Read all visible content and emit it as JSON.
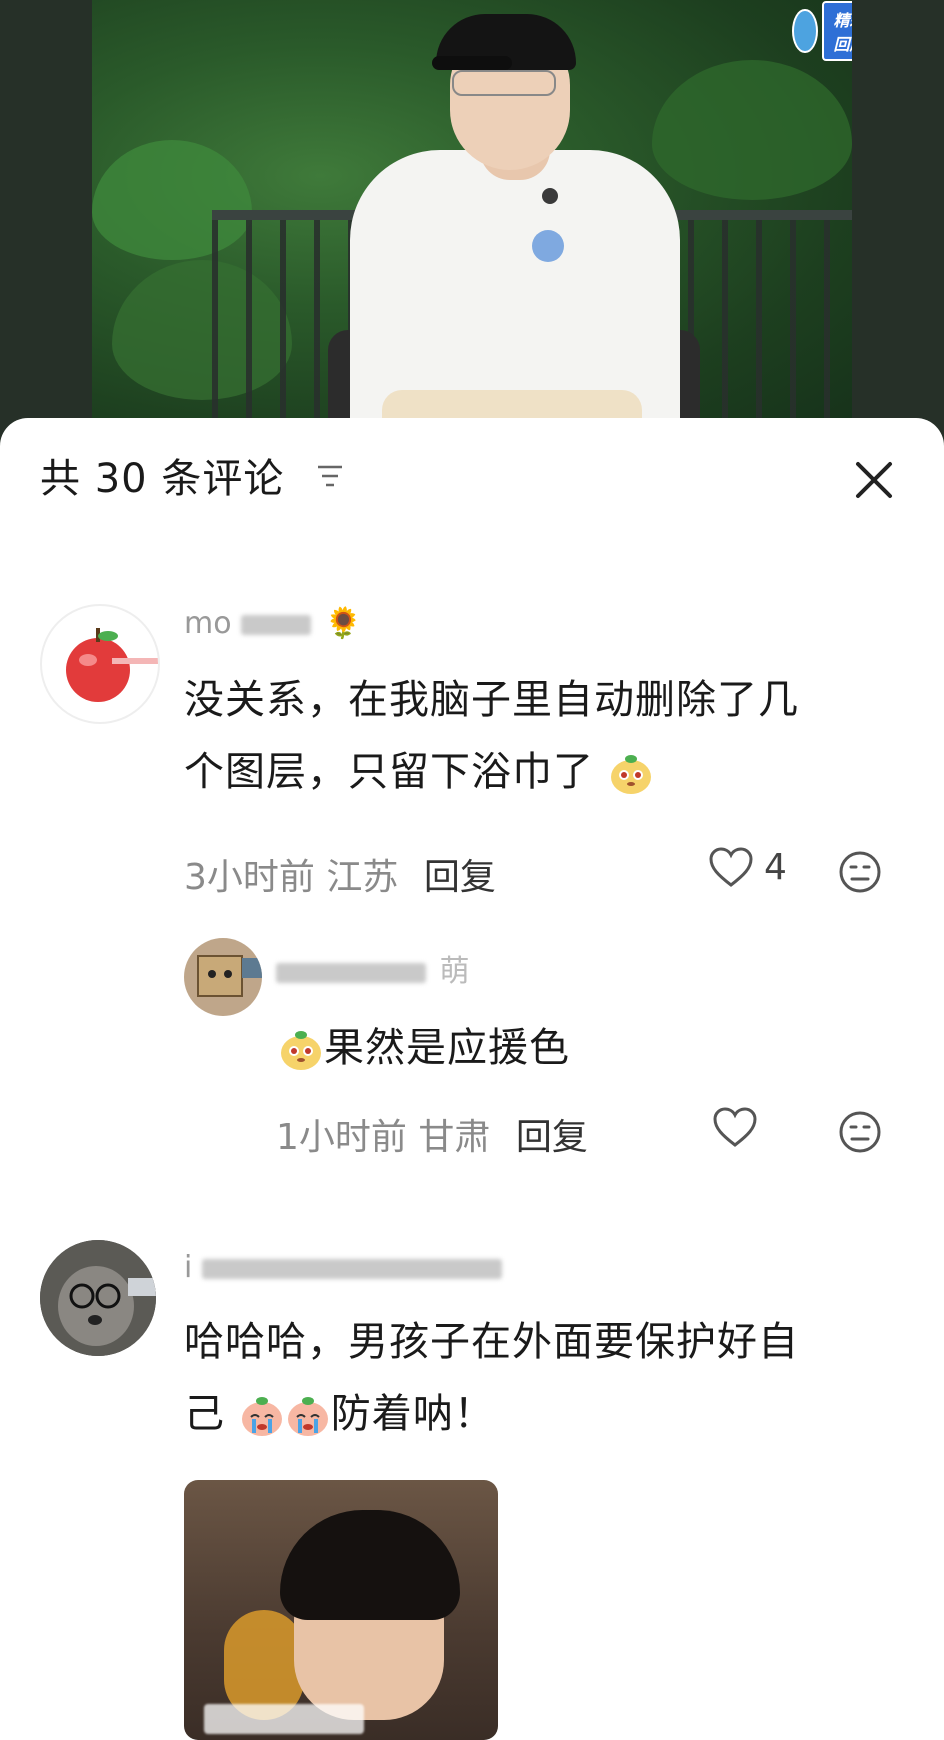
{
  "video": {
    "overlay_tag": "精彩回顾"
  },
  "header": {
    "title": "共 30 条评论",
    "icons": {
      "sort": "sort-lines-icon",
      "close": "close-icon"
    }
  },
  "comments": [
    {
      "username_visible": "mo",
      "username_emoji": "🌻",
      "text_line1": "没关系，在我脑子里自动删除了几",
      "text_line2": "个图层，只留下浴巾了",
      "time": "3小时前",
      "location": "江苏",
      "reply_label": "回复",
      "likes": "4",
      "reply": {
        "username_visible": "萌",
        "text": "果然是应援色",
        "time": "1小时前",
        "location": "甘肃",
        "reply_label": "回复"
      }
    },
    {
      "username_visible": "i",
      "text_line1": "哈哈哈，男孩子在外面要保护好自",
      "text_line2": "己",
      "text_line2_tail": "防着呐！"
    }
  ],
  "colors": {
    "sheet_bg": "#ffffff",
    "meta_text": "#8a8a8a",
    "primary_text": "#1a1a1a",
    "video_bg": "#263028"
  }
}
